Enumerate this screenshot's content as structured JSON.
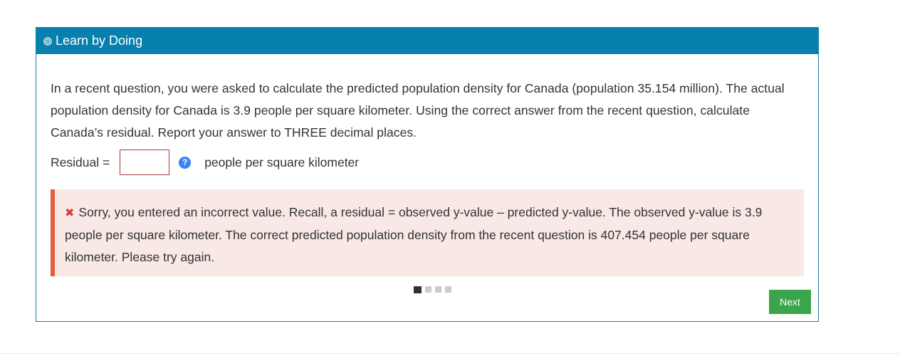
{
  "panel": {
    "header_title": "Learn by Doing",
    "header_icon": "target-icon"
  },
  "question": {
    "text": "In a recent question, you were asked to calculate the predicted population density for Canada (population 35.154 million). The actual population density for Canada is 3.9 people per square kilometer. Using the correct answer from the recent question, calculate Canada’s residual. Report your answer to THREE decimal places."
  },
  "answer": {
    "label": "Residual =",
    "value": "",
    "help_symbol": "?",
    "unit": "people per square kilometer"
  },
  "feedback": {
    "icon": "✖",
    "text": "Sorry, you entered an incorrect value. Recall, a residual = observed y-value – predicted y-value. The observed y-value is 3.9 people per square kilometer. The correct predicted population density from the recent question is 407.454 people per square kilometer. Please try again."
  },
  "pager": {
    "total": 4,
    "current": 1
  },
  "buttons": {
    "next_label": "Next"
  },
  "colors": {
    "header": "#0880ae",
    "feedback_bg": "#f8e8e6",
    "feedback_border": "#e85d3f",
    "next_button": "#3aa54a",
    "help_icon": "#3b82f6"
  }
}
